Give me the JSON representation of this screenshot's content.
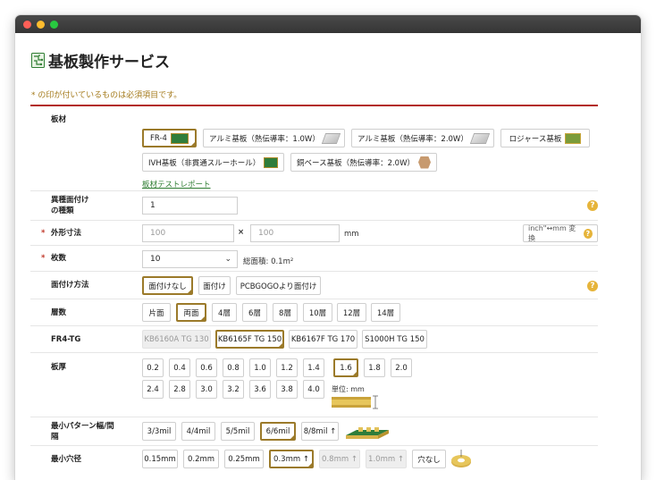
{
  "page": {
    "title": "基板製作サービス",
    "required_note": "* の印が付いているものは必須項目です。"
  },
  "material": {
    "label": "板材",
    "options": [
      "FR-4",
      "アルミ基板（熱伝導率：1.0W）",
      "アルミ基板（熱伝導率：2.0W）",
      "ロジャース基板",
      "IVH基板（非貫通スルーホール）",
      "銅ベース基板（熱伝導率：2.0W）"
    ],
    "selected": "FR-4",
    "report_link": "板材テストレポート"
  },
  "design_types": {
    "label": "異種面付け\nの種類",
    "label_line1": "異種面付け",
    "label_line2": "の種類",
    "value": "1",
    "help": "?"
  },
  "dimensions": {
    "label": "外形寸法",
    "width_placeholder": "100",
    "height_placeholder": "100",
    "separator": "×",
    "unit": "mm",
    "convert_label": "inch\"↔mm 変換",
    "help": "?"
  },
  "quantity": {
    "label": "枚数",
    "value": "10",
    "area_text": "総面積: 0.1m²"
  },
  "panelization": {
    "label": "面付け方法",
    "options": [
      "面付けなし",
      "面付け",
      "PCBGOGOより面付け"
    ],
    "selected": "面付けなし",
    "help": "?"
  },
  "layers": {
    "label": "層数",
    "options": [
      "片面",
      "両面",
      "4層",
      "6層",
      "8層",
      "10層",
      "12層",
      "14層"
    ],
    "selected": "両面"
  },
  "fr4_tg": {
    "label": "FR4-TG",
    "options": [
      "KB6160A TG 130",
      "KB6165F TG 150",
      "KB6167F TG 170",
      "S1000H TG 150"
    ],
    "selected": "KB6165F TG 150",
    "disabled": [
      "KB6160A TG 130"
    ]
  },
  "thickness": {
    "label": "板厚",
    "options_row1": [
      "0.2",
      "0.4",
      "0.6",
      "0.8",
      "1.0",
      "1.2",
      "1.4",
      "1.6",
      "1.8",
      "2.0"
    ],
    "options_row2": [
      "2.4",
      "2.8",
      "3.0",
      "3.2",
      "3.6",
      "3.8",
      "4.0"
    ],
    "selected": "1.6",
    "unit_label": "単位: mm"
  },
  "trace": {
    "label": "最小パターン幅/間隔",
    "options": [
      "3/3mil",
      "4/4mil",
      "5/5mil",
      "6/6mil",
      "8/8mil ↑"
    ],
    "selected": "6/6mil"
  },
  "hole": {
    "label": "最小穴径",
    "options": [
      "0.15mm",
      "0.2mm",
      "0.25mm",
      "0.3mm ↑",
      "0.8mm ↑",
      "1.0mm ↑",
      "穴なし"
    ],
    "selected": "0.3mm ↑",
    "disabled": [
      "0.8mm ↑",
      "1.0mm ↑"
    ]
  },
  "colors": {
    "accent": "#9b7a2a",
    "required_line": "#b3291d",
    "note_text": "#a47a1b",
    "link": "#2e7d32",
    "help": "#e6b43a"
  },
  "icons": {
    "title_logo": "circuit-logo-icon",
    "help": "help-icon",
    "select_chevron": "chevron-down-icon"
  }
}
